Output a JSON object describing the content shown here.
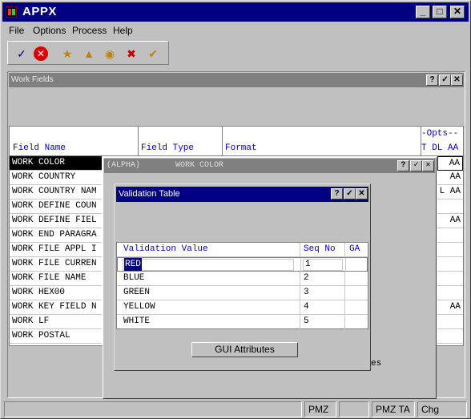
{
  "app": {
    "title": "APPX"
  },
  "window_controls": {
    "minimize": "_",
    "maximize": "□",
    "close": "✕"
  },
  "menu": [
    "File",
    "Options",
    "Process",
    "Help"
  ],
  "toolbar": [
    {
      "icon": "check-edit-icon",
      "glyph": "✓"
    },
    {
      "icon": "cancel-icon",
      "glyph": "✕"
    },
    {
      "icon": "new-folder-icon",
      "glyph": "★"
    },
    {
      "icon": "open-folder-icon",
      "glyph": "▲"
    },
    {
      "icon": "search-folder-icon",
      "glyph": "◉"
    },
    {
      "icon": "delete-folder-icon",
      "glyph": "✖"
    },
    {
      "icon": "check-folder-icon",
      "glyph": "✔"
    }
  ],
  "work_fields": {
    "title": "Work Fields",
    "columns": {
      "field_name": "Field Name",
      "field_type": "Field Type",
      "format": "Format",
      "opts": "-Opts--",
      "opts_sub": "T DL AA"
    },
    "rows": [
      {
        "name": "WORK COLOR",
        "opts": "AA"
      },
      {
        "name": "WORK COUNTRY",
        "opts": "AA"
      },
      {
        "name": "WORK COUNTRY NAM",
        "opts": "L AA"
      },
      {
        "name": "WORK DEFINE COUN",
        "opts": ""
      },
      {
        "name": "WORK DEFINE FIEL",
        "opts": "AA"
      },
      {
        "name": "WORK END PARAGRA",
        "opts": ""
      },
      {
        "name": "WORK FILE APPL I",
        "opts": ""
      },
      {
        "name": "WORK FILE CURREN",
        "opts": ""
      },
      {
        "name": "WORK FILE NAME",
        "opts": ""
      },
      {
        "name": "WORK HEX00",
        "opts": ""
      },
      {
        "name": "WORK KEY FIELD N",
        "opts": "AA"
      },
      {
        "name": "WORK LF",
        "opts": ""
      },
      {
        "name": "WORK POSTAL",
        "opts": ""
      }
    ]
  },
  "work_color": {
    "type_label": "(ALPHA)",
    "title": "WORK COLOR",
    "trailing_text": "es"
  },
  "validation_table": {
    "title": "Validation Table",
    "columns": {
      "value": "Validation Value",
      "seq": "Seq No",
      "ga": "GA"
    },
    "rows": [
      {
        "value": "RED",
        "seq": "1"
      },
      {
        "value": "BLUE",
        "seq": "2"
      },
      {
        "value": "GREEN",
        "seq": "3"
      },
      {
        "value": "YELLOW",
        "seq": "4"
      },
      {
        "value": "WHITE",
        "seq": "5"
      }
    ],
    "gui_button": "GUI Attributes"
  },
  "panel_buttons": {
    "help": "?",
    "ok": "✓",
    "close": "✕"
  },
  "statusbar": {
    "s1": "",
    "s2": "PMZ",
    "s3": "",
    "s4": "PMZ TA",
    "s5": "Chg"
  }
}
